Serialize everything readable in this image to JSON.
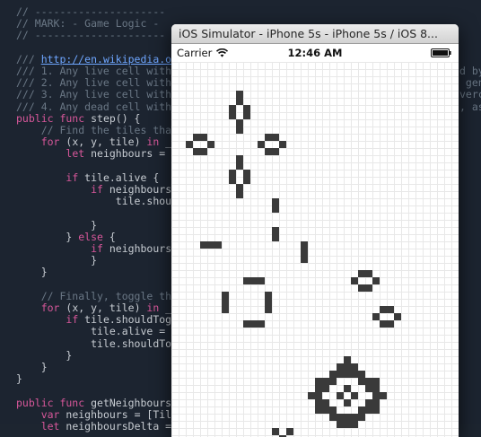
{
  "editor": {
    "lines": [
      [
        {
          "t": "// ---------------------",
          "c": "comment"
        }
      ],
      [
        {
          "t": "// MARK: - Game Logic -",
          "c": "comment"
        }
      ],
      [
        {
          "t": "// ---------------------",
          "c": "comment"
        }
      ],
      [
        {
          "t": "",
          "c": "plain"
        }
      ],
      [
        {
          "t": "/// ",
          "c": "comment"
        },
        {
          "t": "http://en.wikipedia.org",
          "c": "link"
        }
      ],
      [
        {
          "t": "/// 1. Any live cell with",
          "c": "comment"
        }
      ],
      [
        {
          "t": "/// 2. Any live cell with",
          "c": "comment"
        }
      ],
      [
        {
          "t": "/// 3. Any live cell with",
          "c": "comment"
        }
      ],
      [
        {
          "t": "/// 4. Any dead cell with",
          "c": "comment"
        }
      ],
      [
        {
          "t": "public func",
          "c": "keyword"
        },
        {
          "t": " step() {",
          "c": "plain"
        }
      ],
      [
        {
          "t": "    // Find the tiles that",
          "c": "comment"
        }
      ],
      [
        {
          "t": "    ",
          "c": "plain"
        },
        {
          "t": "for",
          "c": "keyword"
        },
        {
          "t": " (x, y, tile) ",
          "c": "plain"
        },
        {
          "t": "in",
          "c": "keyword"
        },
        {
          "t": " _t",
          "c": "plain"
        }
      ],
      [
        {
          "t": "        ",
          "c": "plain"
        },
        {
          "t": "let",
          "c": "keyword"
        },
        {
          "t": " neighbours = ge",
          "c": "plain"
        }
      ],
      [
        {
          "t": "",
          "c": "plain"
        }
      ],
      [
        {
          "t": "        ",
          "c": "plain"
        },
        {
          "t": "if",
          "c": "keyword"
        },
        {
          "t": " tile.alive {",
          "c": "plain"
        }
      ],
      [
        {
          "t": "            ",
          "c": "plain"
        },
        {
          "t": "if",
          "c": "keyword"
        },
        {
          "t": " neighbours.",
          "c": "plain"
        }
      ],
      [
        {
          "t": "                tile.should",
          "c": "plain"
        }
      ],
      [
        {
          "t": "",
          "c": "plain"
        }
      ],
      [
        {
          "t": "            }",
          "c": "plain"
        }
      ],
      [
        {
          "t": "        } ",
          "c": "plain"
        },
        {
          "t": "else",
          "c": "keyword"
        },
        {
          "t": " {",
          "c": "plain"
        }
      ],
      [
        {
          "t": "            ",
          "c": "plain"
        },
        {
          "t": "if",
          "c": "keyword"
        },
        {
          "t": " neighbours.",
          "c": "plain"
        }
      ],
      [
        {
          "t": "            }",
          "c": "plain"
        }
      ],
      [
        {
          "t": "    }",
          "c": "plain"
        }
      ],
      [
        {
          "t": "",
          "c": "plain"
        }
      ],
      [
        {
          "t": "    // Finally, toggle the",
          "c": "comment"
        }
      ],
      [
        {
          "t": "    ",
          "c": "plain"
        },
        {
          "t": "for",
          "c": "keyword"
        },
        {
          "t": " (x, y, tile) ",
          "c": "plain"
        },
        {
          "t": "in",
          "c": "keyword"
        },
        {
          "t": " _t",
          "c": "plain"
        }
      ],
      [
        {
          "t": "        ",
          "c": "plain"
        },
        {
          "t": "if",
          "c": "keyword"
        },
        {
          "t": " tile.shouldTogg",
          "c": "plain"
        }
      ],
      [
        {
          "t": "            tile.alive = !",
          "c": "plain"
        }
      ],
      [
        {
          "t": "            tile.shouldTogg",
          "c": "plain"
        }
      ],
      [
        {
          "t": "        }",
          "c": "plain"
        }
      ],
      [
        {
          "t": "    }",
          "c": "plain"
        }
      ],
      [
        {
          "t": "}",
          "c": "plain"
        }
      ],
      [
        {
          "t": "",
          "c": "plain"
        }
      ],
      [
        {
          "t": "public func",
          "c": "keyword"
        },
        {
          "t": " getNeighbours(",
          "c": "plain"
        }
      ],
      [
        {
          "t": "    ",
          "c": "plain"
        },
        {
          "t": "var",
          "c": "keyword"
        },
        {
          "t": " neighbours = [Tile",
          "c": "plain"
        }
      ],
      [
        {
          "t": "    ",
          "c": "plain"
        },
        {
          "t": "let",
          "c": "keyword"
        },
        {
          "t": " neighboursDelta = ",
          "c": "plain"
        }
      ]
    ],
    "overflow_right": [
      {
        "line": 5,
        "text": "d by"
      },
      {
        "line": 6,
        "text": " gen"
      },
      {
        "line": 7,
        "text": "verc"
      },
      {
        "line": 8,
        "text": ", as"
      }
    ]
  },
  "simulator": {
    "window_title": "iOS Simulator - iPhone 5s - iPhone 5s / iOS 8...",
    "status_bar": {
      "carrier": "Carrier",
      "time": "12:46 AM",
      "wifi_icon": "wifi-icon",
      "battery_icon": "battery-icon"
    },
    "board": {
      "cell_color": "#3a3a3a",
      "live_cells": [
        [
          9,
          4
        ],
        [
          9,
          5
        ],
        [
          8,
          6
        ],
        [
          10,
          6
        ],
        [
          8,
          7
        ],
        [
          10,
          7
        ],
        [
          9,
          8
        ],
        [
          9,
          9
        ],
        [
          3,
          10
        ],
        [
          4,
          10
        ],
        [
          2,
          11
        ],
        [
          5,
          11
        ],
        [
          3,
          12
        ],
        [
          4,
          12
        ],
        [
          13,
          10
        ],
        [
          14,
          10
        ],
        [
          12,
          11
        ],
        [
          15,
          11
        ],
        [
          13,
          12
        ],
        [
          14,
          12
        ],
        [
          9,
          13
        ],
        [
          9,
          14
        ],
        [
          8,
          15
        ],
        [
          10,
          15
        ],
        [
          8,
          16
        ],
        [
          10,
          16
        ],
        [
          9,
          17
        ],
        [
          9,
          18
        ],
        [
          14,
          19
        ],
        [
          14,
          20
        ],
        [
          14,
          23
        ],
        [
          14,
          24
        ],
        [
          4,
          25
        ],
        [
          5,
          25
        ],
        [
          6,
          25
        ],
        [
          18,
          25
        ],
        [
          18,
          26
        ],
        [
          18,
          27
        ],
        [
          10,
          30
        ],
        [
          11,
          30
        ],
        [
          12,
          30
        ],
        [
          7,
          32
        ],
        [
          7,
          33
        ],
        [
          7,
          34
        ],
        [
          13,
          32
        ],
        [
          13,
          33
        ],
        [
          13,
          34
        ],
        [
          10,
          36
        ],
        [
          11,
          36
        ],
        [
          12,
          36
        ],
        [
          26,
          29
        ],
        [
          27,
          29
        ],
        [
          25,
          30
        ],
        [
          28,
          30
        ],
        [
          26,
          31
        ],
        [
          27,
          31
        ],
        [
          29,
          34
        ],
        [
          30,
          34
        ],
        [
          28,
          35
        ],
        [
          31,
          35
        ],
        [
          29,
          36
        ],
        [
          30,
          36
        ],
        [
          24,
          41
        ],
        [
          23,
          42
        ],
        [
          24,
          42
        ],
        [
          25,
          42
        ],
        [
          22,
          43
        ],
        [
          23,
          43
        ],
        [
          24,
          43
        ],
        [
          25,
          43
        ],
        [
          26,
          43
        ],
        [
          20,
          44
        ],
        [
          21,
          44
        ],
        [
          22,
          44
        ],
        [
          26,
          44
        ],
        [
          27,
          44
        ],
        [
          28,
          44
        ],
        [
          20,
          45
        ],
        [
          21,
          45
        ],
        [
          24,
          45
        ],
        [
          27,
          45
        ],
        [
          28,
          45
        ],
        [
          19,
          46
        ],
        [
          20,
          46
        ],
        [
          23,
          46
        ],
        [
          25,
          46
        ],
        [
          28,
          46
        ],
        [
          29,
          46
        ],
        [
          20,
          47
        ],
        [
          21,
          47
        ],
        [
          24,
          47
        ],
        [
          27,
          47
        ],
        [
          28,
          47
        ],
        [
          20,
          48
        ],
        [
          21,
          48
        ],
        [
          22,
          48
        ],
        [
          26,
          48
        ],
        [
          27,
          48
        ],
        [
          28,
          48
        ],
        [
          22,
          49
        ],
        [
          23,
          49
        ],
        [
          24,
          49
        ],
        [
          25,
          49
        ],
        [
          26,
          49
        ],
        [
          23,
          50
        ],
        [
          24,
          50
        ],
        [
          25,
          50
        ],
        [
          14,
          51
        ],
        [
          16,
          51
        ],
        [
          15,
          52
        ],
        [
          14,
          53
        ],
        [
          15,
          53
        ]
      ]
    }
  }
}
